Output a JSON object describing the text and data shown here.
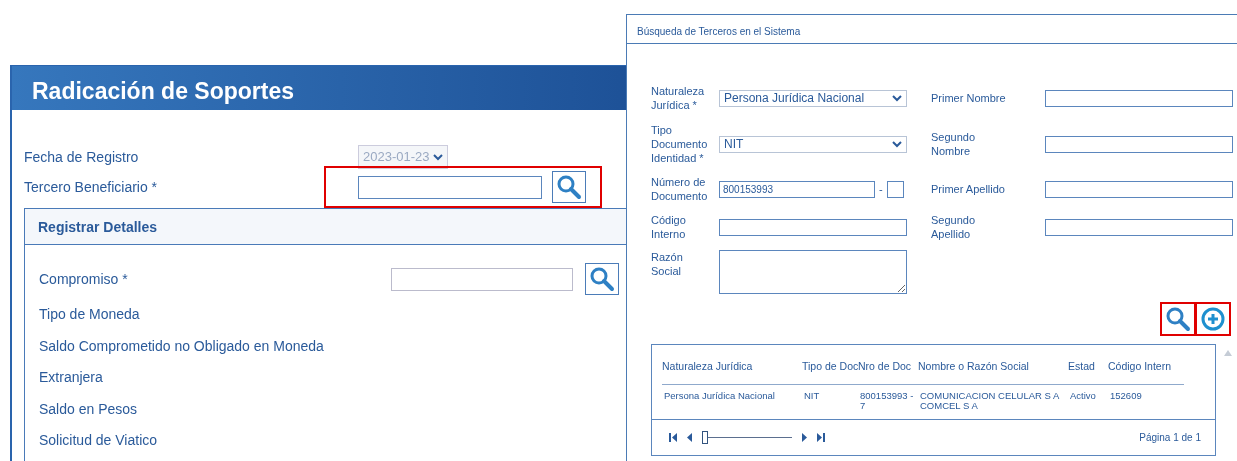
{
  "main_panel": {
    "title": "Radicación de Soportes",
    "fields": [
      {
        "label": "Fecha de Registro",
        "kind": "date",
        "value": "2023-01-23",
        "highlighted": false
      },
      {
        "label": "Tercero Beneficiario *",
        "kind": "lookup",
        "highlighted": true
      }
    ],
    "details": {
      "title": "Registrar Detalles",
      "fields": [
        {
          "label": "Compromiso *",
          "kind": "lookup"
        },
        {
          "label": "Tipo de Moneda",
          "kind": "text"
        },
        {
          "label": "Saldo Comprometido no Obligado en Moneda",
          "kind": "text"
        },
        {
          "label": "Extranjera",
          "kind": "text"
        },
        {
          "label": "Saldo en Pesos",
          "kind": "text"
        },
        {
          "label": "Solicitud de Viatico",
          "kind": "text"
        }
      ]
    }
  },
  "dialog": {
    "title": "Búsqueda de Terceros en el Sistema",
    "left_fields": [
      {
        "label": "Naturaleza Jurídica *",
        "kind": "select",
        "value": "Persona Jurídica Nacional"
      },
      {
        "label": "Tipo Documento Identidad *",
        "kind": "select",
        "value": "NIT"
      },
      {
        "label": "Número de Documento",
        "kind": "document",
        "value": "800153993",
        "separator": "-"
      },
      {
        "label": "Código Interno",
        "kind": "input"
      },
      {
        "label": "Razón Social",
        "kind": "textarea"
      }
    ],
    "right_fields": [
      {
        "label": "Primer Nombre"
      },
      {
        "label": "Segundo Nombre"
      },
      {
        "label": "Primer Apellido"
      },
      {
        "label": "Segundo Apellido"
      }
    ],
    "actions": [
      {
        "kind": "search",
        "highlighted": true
      },
      {
        "kind": "add",
        "highlighted": true
      }
    ],
    "table": {
      "columns": [
        "Naturaleza Jurídica",
        "Tipo de Doc",
        "Nro de Doc",
        "Nombre o Razón Social",
        "Estad",
        "Código Intern"
      ],
      "rows": [
        [
          "Persona Jurídica Nacional",
          "NIT",
          "800153993 - 7",
          "COMUNICACION CELULAR S A COMCEL S A",
          "Activo",
          "152609"
        ]
      ]
    },
    "pager": {
      "level": 0,
      "text": "Página 1 de 1"
    }
  }
}
